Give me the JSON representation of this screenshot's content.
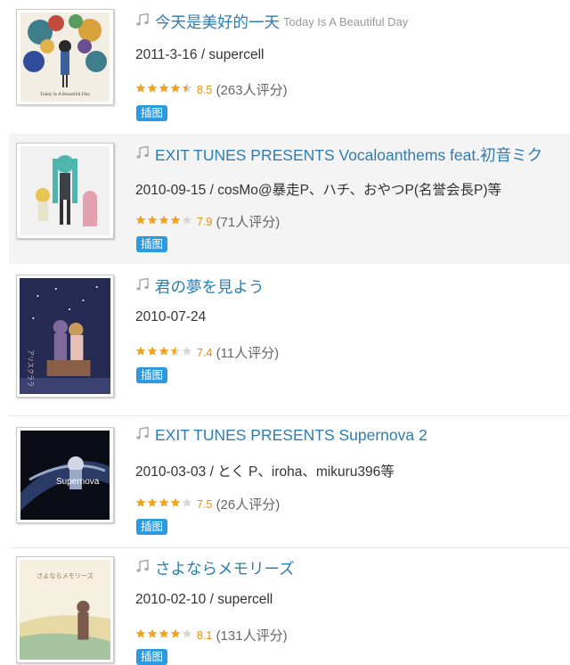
{
  "albums": [
    {
      "title": "今天是美好的一天",
      "subtitle": "Today Is A Beautiful Day",
      "meta": "2011-3-16 / supercell",
      "rating": 8.5,
      "score": "8.5",
      "votes": "(263人评分)",
      "tag": "插图",
      "cover_caption": "Today Is A Beautiful Day",
      "cover_palette": [
        "#f2eee4",
        "#3e7d8c",
        "#d8a13b",
        "#2f4d9a"
      ]
    },
    {
      "title": "EXIT TUNES PRESENTS Vocaloanthems feat.初音ミク",
      "subtitle": "",
      "meta": "2010-09-15 / cosMo@暴走P、ハチ、おやつP(名誉会長P)等",
      "rating": 7.9,
      "score": "7.9",
      "votes": "(71人评分)",
      "tag": "插图",
      "cover_caption": "",
      "cover_palette": [
        "#f1f1f1",
        "#4fb6ad",
        "#e3a0ad",
        "#e8c34d"
      ]
    },
    {
      "title": "君の夢を見よう",
      "subtitle": "",
      "meta": "2010-07-24",
      "rating": 7.4,
      "score": "7.4",
      "votes": "(11人评分)",
      "tag": "插图",
      "cover_caption": "君の夢を見よう",
      "cover_palette": [
        "#242a52",
        "#7b6a9a",
        "#c99b5a",
        "#e7c0b8"
      ]
    },
    {
      "title": "EXIT TUNES PRESENTS Supernova 2",
      "subtitle": "",
      "meta": "2010-03-03 / とく P、iroha、mikuru396等",
      "rating": 7.5,
      "score": "7.5",
      "votes": "(26人评分)",
      "tag": "插图",
      "cover_caption": "Supernova",
      "cover_palette": [
        "#0b0d16",
        "#2a3b66",
        "#9aa8c8",
        "#ffffff"
      ]
    },
    {
      "title": "さよならメモリーズ",
      "subtitle": "",
      "meta": "2010-02-10 / supercell",
      "rating": 8.1,
      "score": "8.1",
      "votes": "(131人评分)",
      "tag": "插图",
      "cover_caption": "さよならメモリーズ",
      "cover_palette": [
        "#f5f0e0",
        "#e7d9a5",
        "#a7c4a0",
        "#7a5a4a"
      ]
    }
  ],
  "colors": {
    "title": "#2e7db1",
    "star_on": "#f0a21e",
    "star_off": "#d8d8d8",
    "tag_bg": "#2c9ae0"
  }
}
